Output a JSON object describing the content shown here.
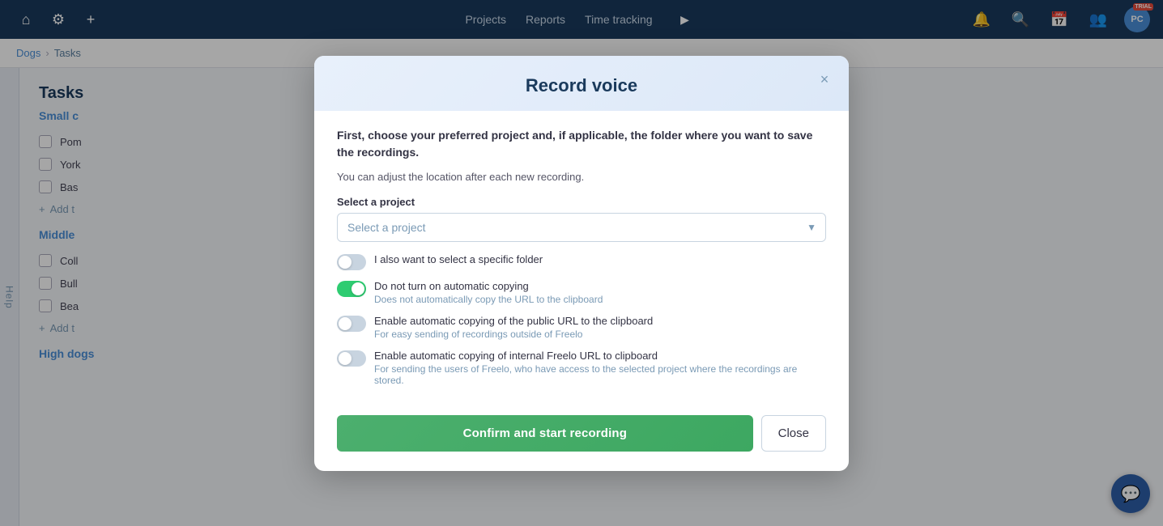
{
  "topnav": {
    "links": [
      "Projects",
      "Reports",
      "Time tracking"
    ],
    "play_icon": "▶",
    "home_icon": "⌂",
    "settings_icon": "⚙",
    "add_icon": "+",
    "bell_icon": "🔔",
    "search_icon": "🔍",
    "calendar_icon": "📅",
    "team_icon": "👥",
    "avatar_text": "PC",
    "avatar_badge": "TRIAL"
  },
  "breadcrumb": {
    "items": [
      "Dogs",
      "Tasks"
    ]
  },
  "sidebar": {
    "help_label": "Help"
  },
  "tasks": {
    "title": "Tasks",
    "sections": [
      {
        "name": "Small c",
        "items": [
          "Pom",
          "York",
          "Bas"
        ],
        "add_label": "Add t"
      },
      {
        "name": "Middle",
        "items": [
          "Coll",
          "Bull",
          "Bea"
        ],
        "add_label": "Add t"
      },
      {
        "name": "High dogs"
      }
    ]
  },
  "modal": {
    "title": "Record voice",
    "intro_html": "First, choose your preferred project and, if applicable, the folder where you want to save the recordings.",
    "note": "You can adjust the location after each new recording.",
    "project_label": "Select a project",
    "project_placeholder": "Select a project",
    "close_label": "×",
    "toggles": [
      {
        "id": "folder-toggle",
        "state": "off",
        "main_label": "I also want to select a specific folder",
        "sub_label": ""
      },
      {
        "id": "auto-copy-toggle",
        "state": "on",
        "main_label": "Do not turn on automatic copying",
        "sub_label": "Does not automatically copy the URL to the clipboard"
      },
      {
        "id": "public-url-toggle",
        "state": "off",
        "main_label": "Enable automatic copying of the public URL to the clipboard",
        "sub_label": "For easy sending of recordings outside of Freelo"
      },
      {
        "id": "internal-url-toggle",
        "state": "off",
        "main_label": "Enable automatic copying of internal Freelo URL to clipboard",
        "sub_label": "For sending the users of Freelo, who have access to the selected project where the recordings are stored."
      }
    ],
    "confirm_label": "Confirm and start recording",
    "close_btn_label": "Close"
  }
}
